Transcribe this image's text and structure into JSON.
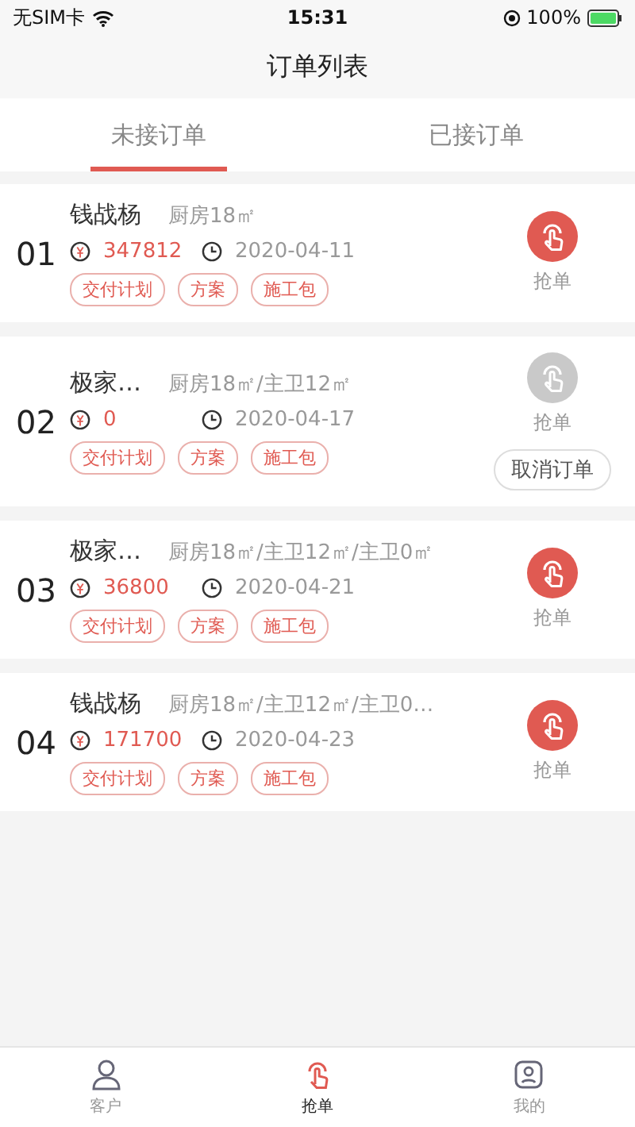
{
  "status_bar": {
    "carrier": "无SIM卡",
    "time": "15:31",
    "battery": "100%"
  },
  "nav": {
    "title": "订单列表"
  },
  "tabs": [
    {
      "label": "未接订单",
      "selected": true
    },
    {
      "label": "已接订单",
      "selected": false
    }
  ],
  "orders": [
    {
      "number": "01",
      "name": "钱战杨",
      "area": "厨房18㎡",
      "price": "347812",
      "date": "2020-04-11",
      "tags": [
        "交付计划",
        "方案",
        "施工包"
      ],
      "grab": {
        "label": "抢单",
        "disabled": false
      }
    },
    {
      "number": "02",
      "name": "极家…",
      "area": "厨房18㎡/主卫12㎡",
      "price": "0",
      "date": "2020-04-17",
      "tags": [
        "交付计划",
        "方案",
        "施工包"
      ],
      "grab": {
        "label": "抢单",
        "disabled": true
      },
      "cancel": "取消订单"
    },
    {
      "number": "03",
      "name": "极家…",
      "area": "厨房18㎡/主卫12㎡/主卫0㎡",
      "price": "36800",
      "date": "2020-04-21",
      "tags": [
        "交付计划",
        "方案",
        "施工包"
      ],
      "grab": {
        "label": "抢单",
        "disabled": false
      }
    },
    {
      "number": "04",
      "name": "钱战杨",
      "area": "厨房18㎡/主卫12㎡/主卫0…",
      "price": "171700",
      "date": "2020-04-23",
      "tags": [
        "交付计划",
        "方案",
        "施工包"
      ],
      "grab": {
        "label": "抢单",
        "disabled": false
      }
    }
  ],
  "tab_bar": [
    {
      "label": "客户",
      "kind": "person",
      "selected": false
    },
    {
      "label": "抢单",
      "kind": "grab",
      "selected": true
    },
    {
      "label": "我的",
      "kind": "me",
      "selected": false
    }
  ]
}
